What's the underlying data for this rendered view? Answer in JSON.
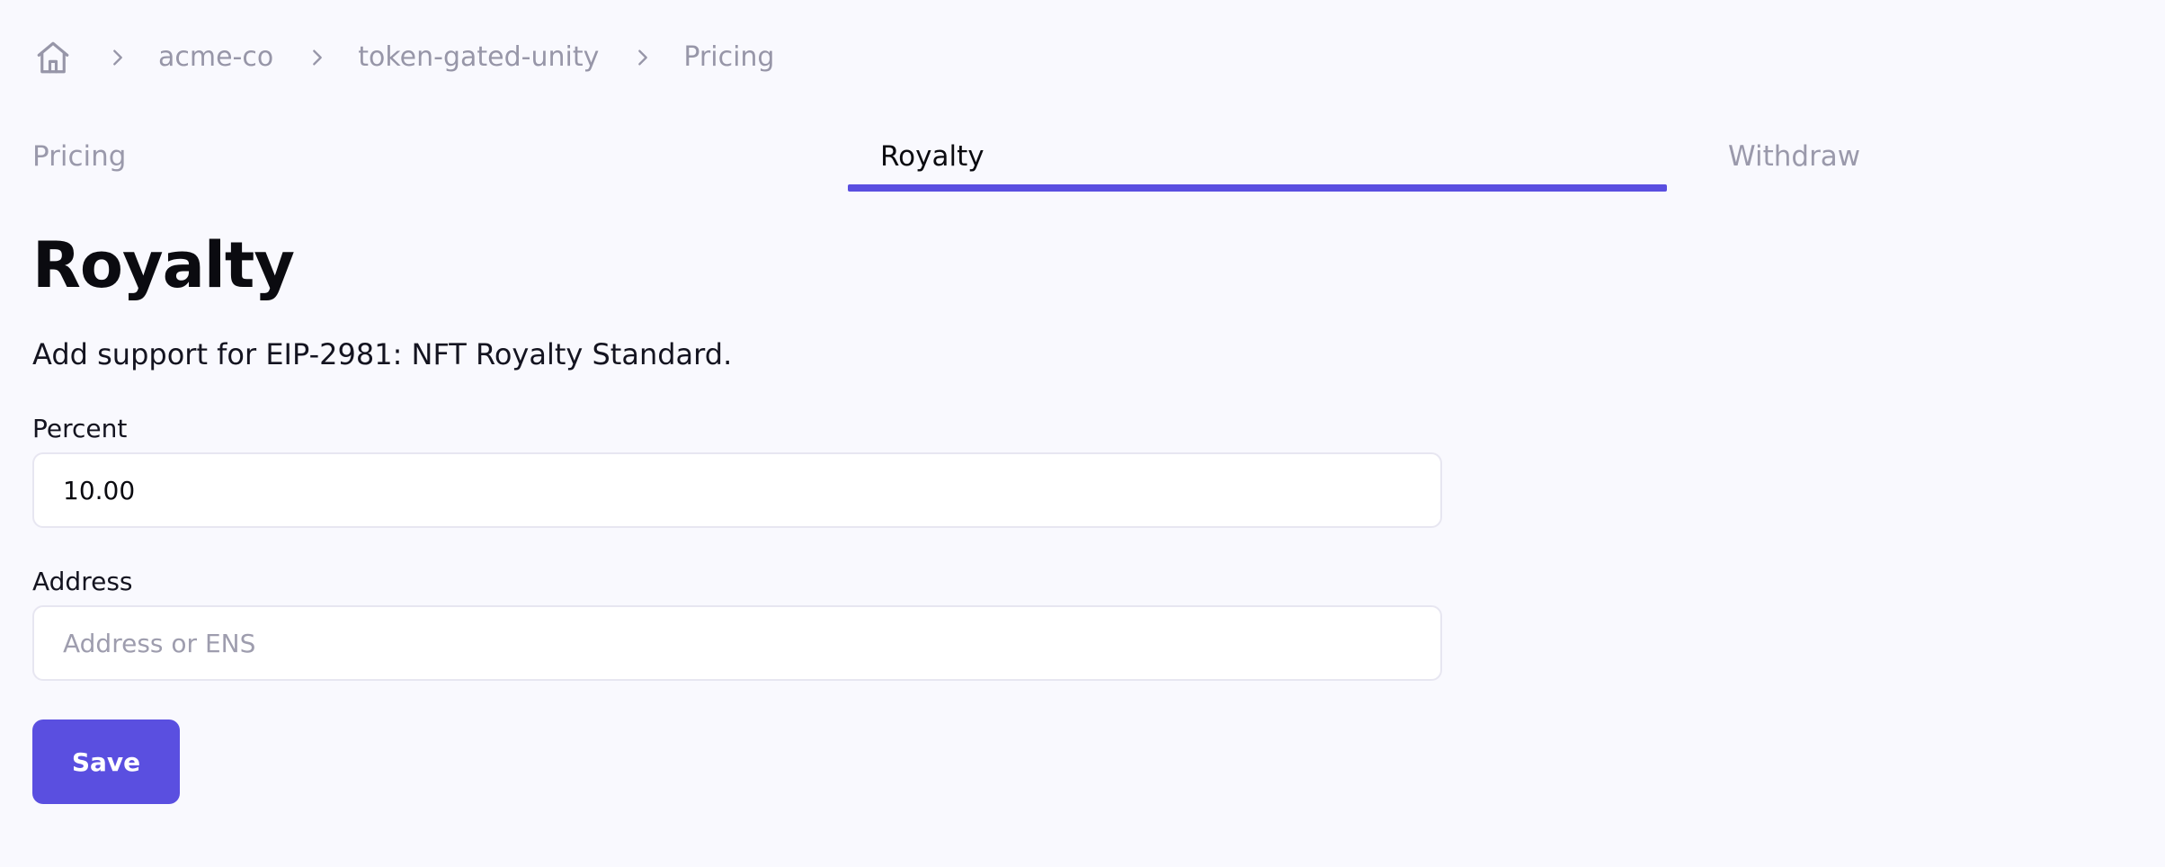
{
  "breadcrumb": {
    "home_icon": "home-icon",
    "items": [
      "acme-co",
      "token-gated-unity",
      "Pricing"
    ]
  },
  "tabs": [
    {
      "label": "Pricing",
      "active": false
    },
    {
      "label": "Royalty",
      "active": true
    },
    {
      "label": "Withdraw",
      "active": false
    }
  ],
  "page": {
    "title": "Royalty",
    "description": "Add support for EIP-2981: NFT Royalty Standard."
  },
  "form": {
    "percent_label": "Percent",
    "percent_value": "10.00",
    "address_label": "Address",
    "address_placeholder": "Address or ENS",
    "address_value": "",
    "save_label": "Save"
  },
  "colors": {
    "accent": "#5a4fe0",
    "background": "#f9f9fe",
    "muted_text": "#9796a8"
  }
}
